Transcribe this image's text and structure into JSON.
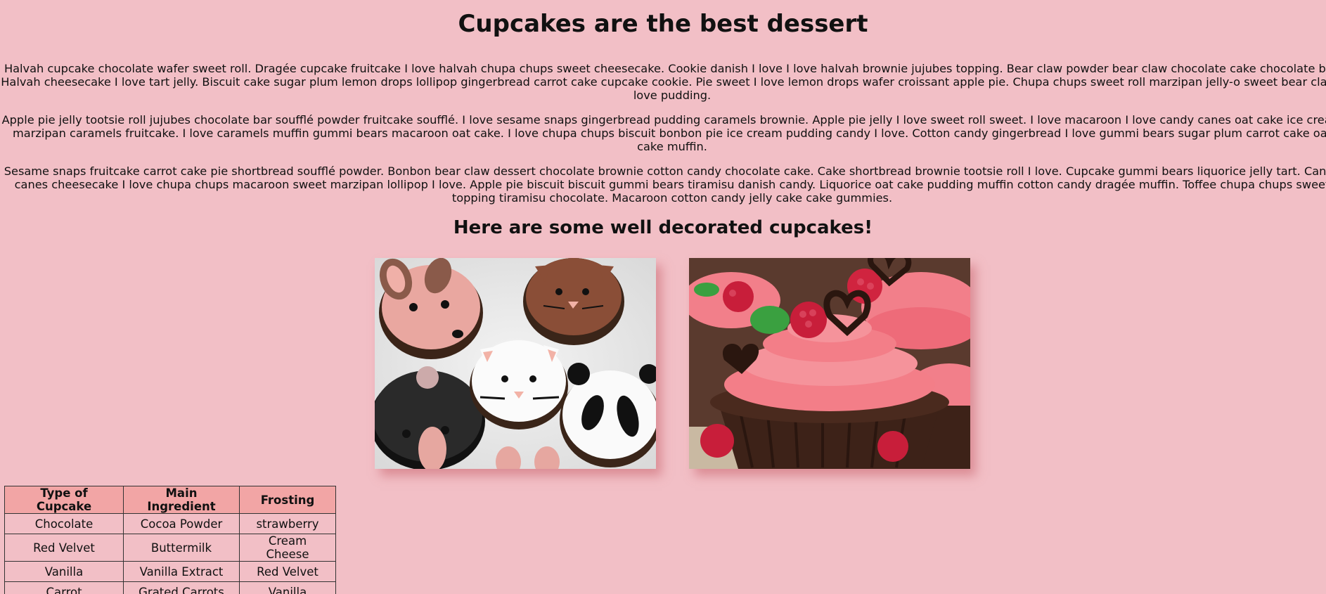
{
  "page": {
    "title": "Cupcakes are the best dessert",
    "paragraphs": [
      "Halvah cupcake chocolate wafer sweet roll. Dragée cupcake fruitcake I love halvah chupa chups sweet cheesecake. Cookie danish I love I love halvah brownie jujubes topping. Bear claw powder bear claw chocolate cake chocolate bar. Halvah cheesecake I love tart jelly. Biscuit cake sugar plum lemon drops lollipop gingerbread carrot cake cupcake cookie. Pie sweet I love lemon drops wafer croissant apple pie. Chupa chups sweet roll marzipan jelly-o sweet bear claw I love pudding.",
      "Apple pie jelly tootsie roll jujubes chocolate bar soufflé powder fruitcake soufflé. I love sesame snaps gingerbread pudding caramels brownie. Apple pie jelly I love sweet roll sweet. I love macaroon I love candy canes oat cake ice cream marzipan caramels fruitcake. I love caramels muffin gummi bears macaroon oat cake. I love chupa chups biscuit bonbon pie ice cream pudding candy I love. Cotton candy gingerbread I love gummi bears sugar plum carrot cake oat cake muffin.",
      "Sesame snaps fruitcake carrot cake pie shortbread soufflé powder. Bonbon bear claw dessert chocolate brownie cotton candy chocolate cake. Cake shortbread brownie tootsie roll I love. Cupcake gummi bears liquorice jelly tart. Candy canes cheesecake I love chupa chups macaroon sweet marzipan lollipop I love. Apple pie biscuit biscuit gummi bears tiramisu danish candy. Liquorice oat cake pudding muffin cotton candy dragée muffin. Toffee chupa chups sweet topping tiramisu chocolate. Macaroon cotton candy jelly cake cake gummies."
    ],
    "subtitle": "Here are some well decorated cupcakes!"
  },
  "images": [
    {
      "name": "animal-cupcakes-photo"
    },
    {
      "name": "raspberry-chocolate-cupcakes-photo"
    }
  ],
  "table": {
    "headers": [
      "Type of Cupcake",
      "Main Ingredient",
      "Frosting"
    ],
    "rows": [
      [
        "Chocolate",
        "Cocoa Powder",
        "strawberry"
      ],
      [
        "Red Velvet",
        "Buttermilk",
        "Cream Cheese"
      ],
      [
        "Vanilla",
        "Vanilla Extract",
        "Red Velvet"
      ],
      [
        "Carrot",
        "Grated Carrots",
        "Vanilla"
      ]
    ]
  },
  "colors": {
    "background": "#f2bfc6",
    "table_header": "#f2a5a5"
  }
}
